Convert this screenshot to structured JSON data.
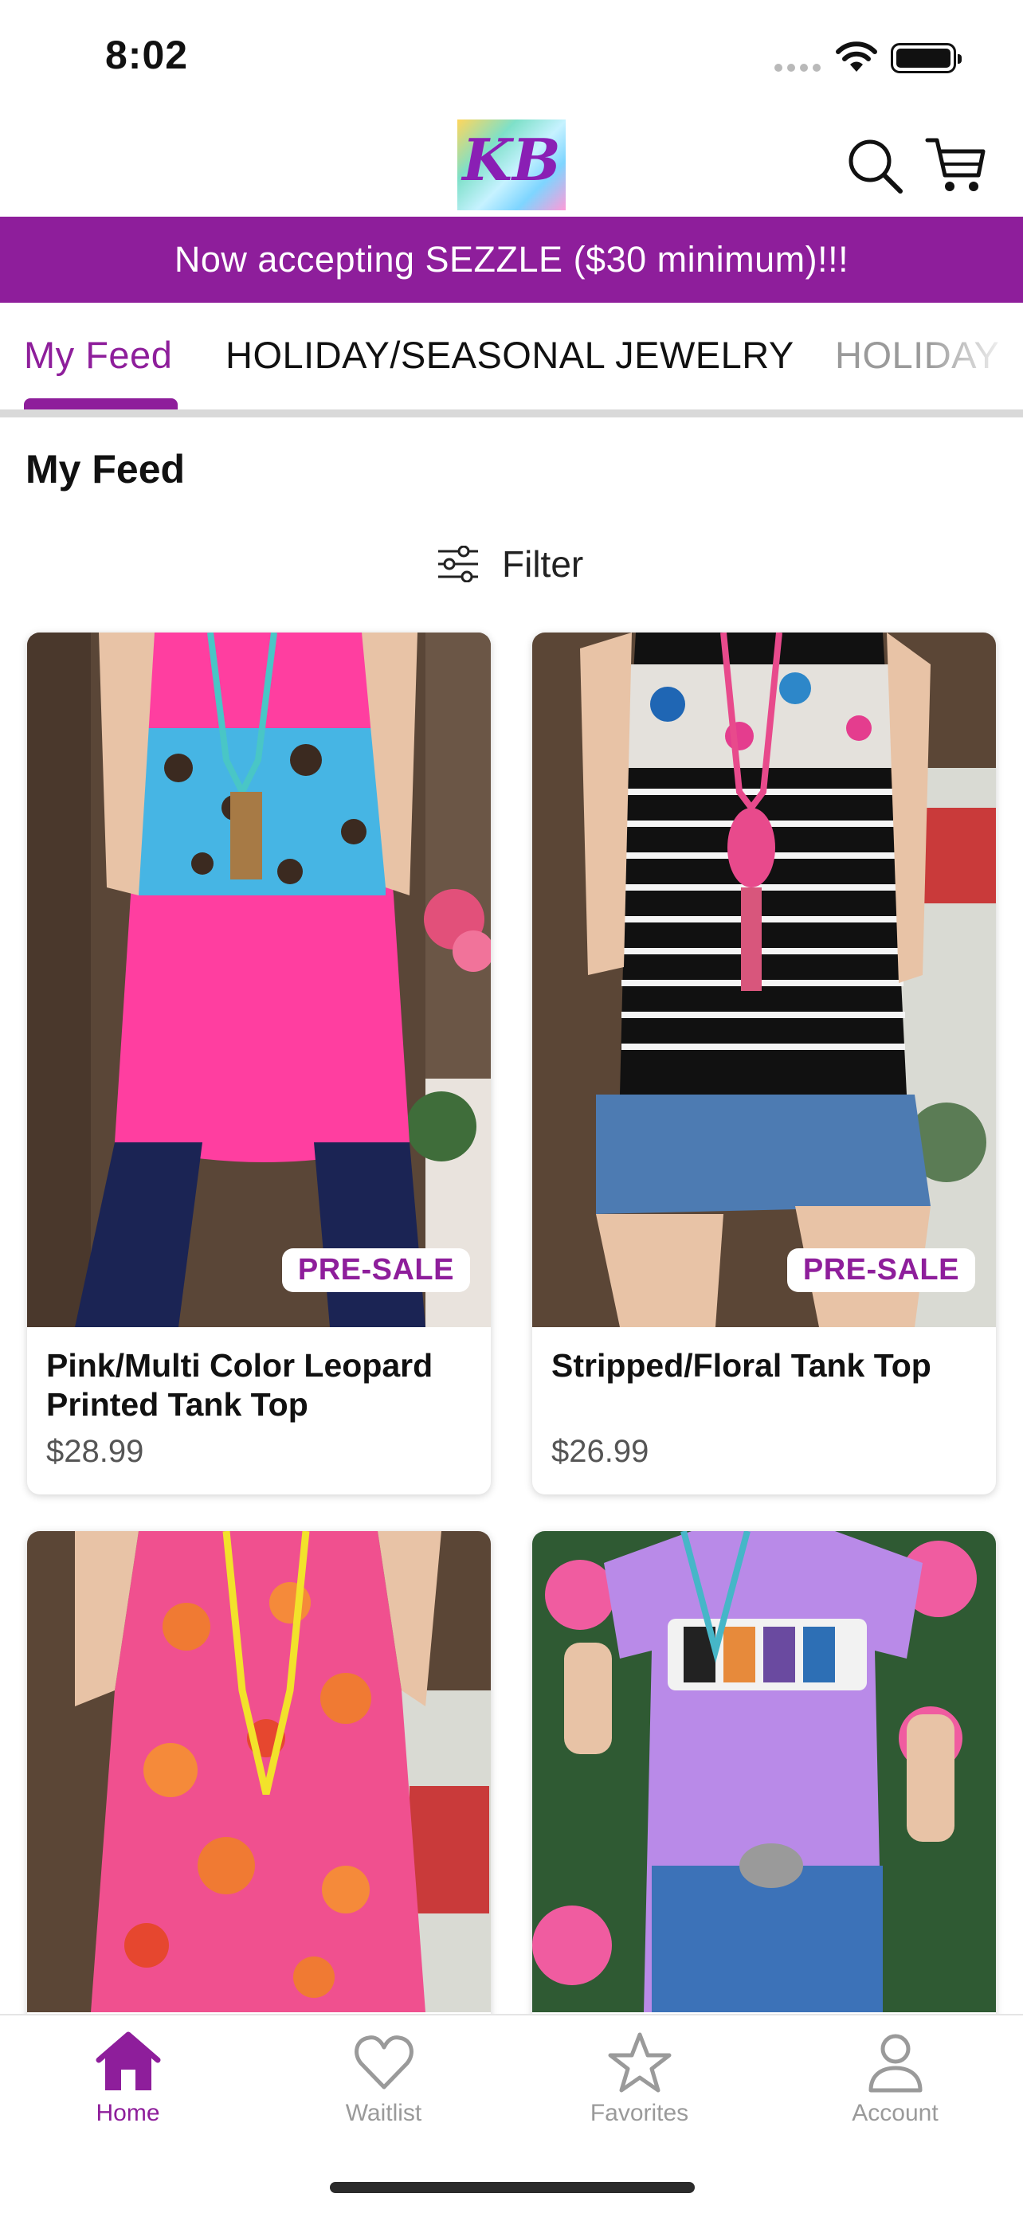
{
  "status_bar": {
    "time": "8:02"
  },
  "header": {
    "logo_text": "KB",
    "search_icon": "search-icon",
    "cart_icon": "cart-icon"
  },
  "banner": {
    "text": "Now accepting SEZZLE ($30 minimum)!!!"
  },
  "tabs": [
    {
      "label": "My Feed",
      "active": true
    },
    {
      "label": "HOLIDAY/SEASONAL JEWELRY",
      "active": false
    },
    {
      "label": "HOLIDAY",
      "active": false
    }
  ],
  "section": {
    "title": "My Feed"
  },
  "filter": {
    "label": "Filter",
    "icon": "sliders-icon"
  },
  "products": [
    {
      "title": "Pink/Multi Color Leopard Printed Tank Top",
      "price": "$28.99",
      "badge": "PRE-SALE"
    },
    {
      "title": "Stripped/Floral Tank Top",
      "price": "$26.99",
      "badge": "PRE-SALE"
    },
    {
      "title": "",
      "price": "",
      "badge": ""
    },
    {
      "title": "",
      "price": "",
      "badge": ""
    }
  ],
  "bottom_nav": [
    {
      "label": "Home",
      "icon": "home-icon",
      "active": true
    },
    {
      "label": "Waitlist",
      "icon": "heart-icon",
      "active": false
    },
    {
      "label": "Favorites",
      "icon": "star-icon",
      "active": false
    },
    {
      "label": "Account",
      "icon": "person-icon",
      "active": false
    }
  ],
  "colors": {
    "accent": "#8e1e9b",
    "inactive": "#9a9a9a",
    "divider": "#d9d9d9"
  }
}
